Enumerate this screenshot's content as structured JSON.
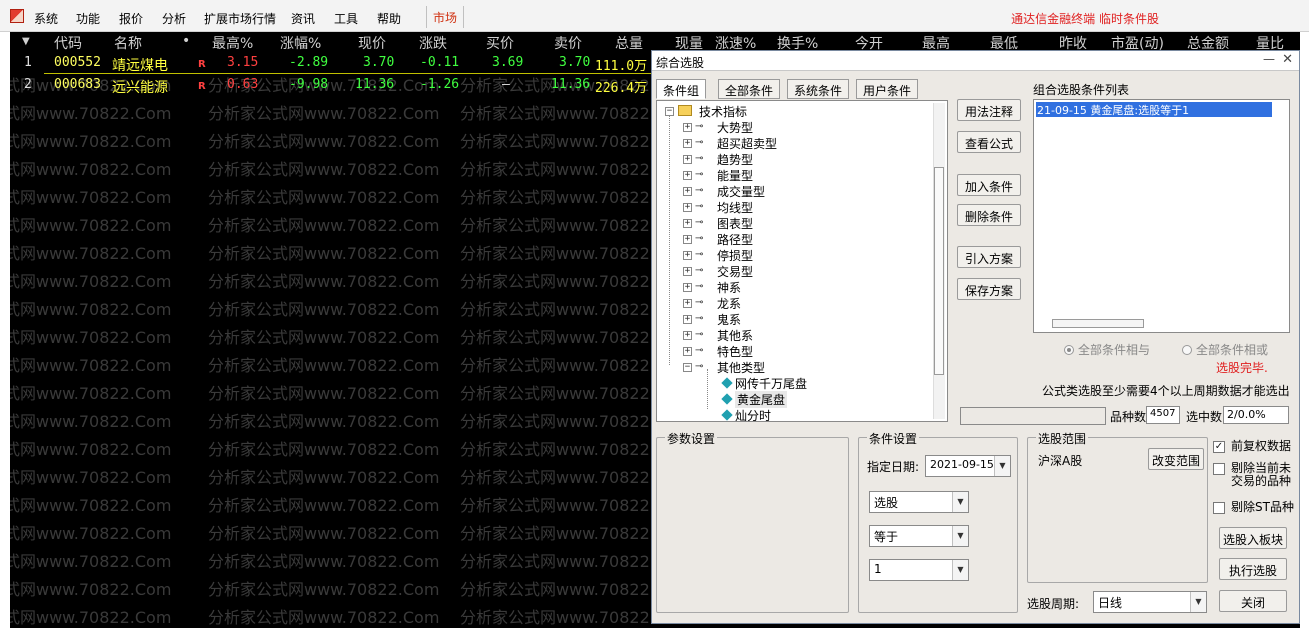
{
  "menubar": {
    "items": [
      "系统",
      "功能",
      "报价",
      "分析",
      "扩展市场行情",
      "资讯",
      "工具",
      "帮助"
    ],
    "market": "市场",
    "app_title": "通达信金融终端  临时条件股"
  },
  "board": {
    "columns": [
      "代码",
      "名称",
      "•",
      "最高%",
      "涨幅%",
      "现价",
      "涨跌",
      "买价",
      "卖价",
      "总量",
      "现量",
      "涨速%",
      "换手%",
      "今开",
      "最高",
      "最低",
      "昨收",
      "市盈(动)",
      "总金额",
      "量比"
    ],
    "rows": [
      {
        "idx": "1",
        "code": "000552",
        "name": "靖远煤电",
        "flag": "R",
        "max_pct": "3.15",
        "chg_pct": "-2.89",
        "price": "3.70",
        "chg": "-0.11",
        "bid": "3.69",
        "ask": "3.70",
        "vol": "111.0万"
      },
      {
        "idx": "2",
        "code": "000683",
        "name": "远兴能源",
        "flag": "R",
        "max_pct": "0.63",
        "chg_pct": "-9.98",
        "price": "11.36",
        "chg": "-1.26",
        "bid": "—",
        "ask": "11.36",
        "vol": "226.4万"
      }
    ],
    "watermark_a": "式网www.70822.Com",
    "watermark_b": "分析家公式网www.70822.Com"
  },
  "dialog": {
    "title": "综合选股",
    "min": "—",
    "close": "✕",
    "tabs": [
      "条件组",
      "全部条件",
      "系统条件",
      "用户条件"
    ],
    "tree": {
      "root": "技术指标",
      "groups": [
        "大势型",
        "超买超卖型",
        "趋势型",
        "能量型",
        "成交量型",
        "均线型",
        "图表型",
        "路径型",
        "停损型",
        "交易型",
        "神系",
        "龙系",
        "鬼系",
        "其他系",
        "特色型",
        "其他类型"
      ],
      "leaves": [
        "网传千万尾盘",
        "黄金尾盘",
        "灿分时"
      ]
    },
    "buttons": {
      "usage_note": "用法注释",
      "view_formula": "查看公式",
      "add_cond": "加入条件",
      "del_cond": "删除条件",
      "import_plan": "引入方案",
      "save_plan": "保存方案"
    },
    "cond_list_label": "组合选股条件列表",
    "cond_list_items": [
      "21-09-15  黄金尾盘:选股等于1"
    ],
    "radio_and": "全部条件相与",
    "radio_or": "全部条件相或",
    "status": "选股完毕.",
    "notice": "公式类选股至少需要4个以上周期数据才能选出",
    "count_label": "品种数",
    "count_value": "4507",
    "selected_label": "选中数",
    "selected_value": "2/0.0%",
    "param_group": "参数设置",
    "cond_group": "条件设置",
    "date_label": "指定日期:",
    "date_value": "2021-09-15",
    "cond_field": "选股",
    "cond_op": "等于",
    "cond_val": "1",
    "scope_group": "选股范围",
    "scope_value": "沪深A股",
    "change_scope": "改变范围",
    "opt_prerights": "前复权数据",
    "opt_exclude_untradable": "剔除当前未交易的品种",
    "opt_exclude_st": "剔除ST品种",
    "select_to_block": "选股入板块",
    "run_select": "执行选股",
    "period_label": "选股周期:",
    "period_value": "日线",
    "close_btn": "关闭"
  }
}
